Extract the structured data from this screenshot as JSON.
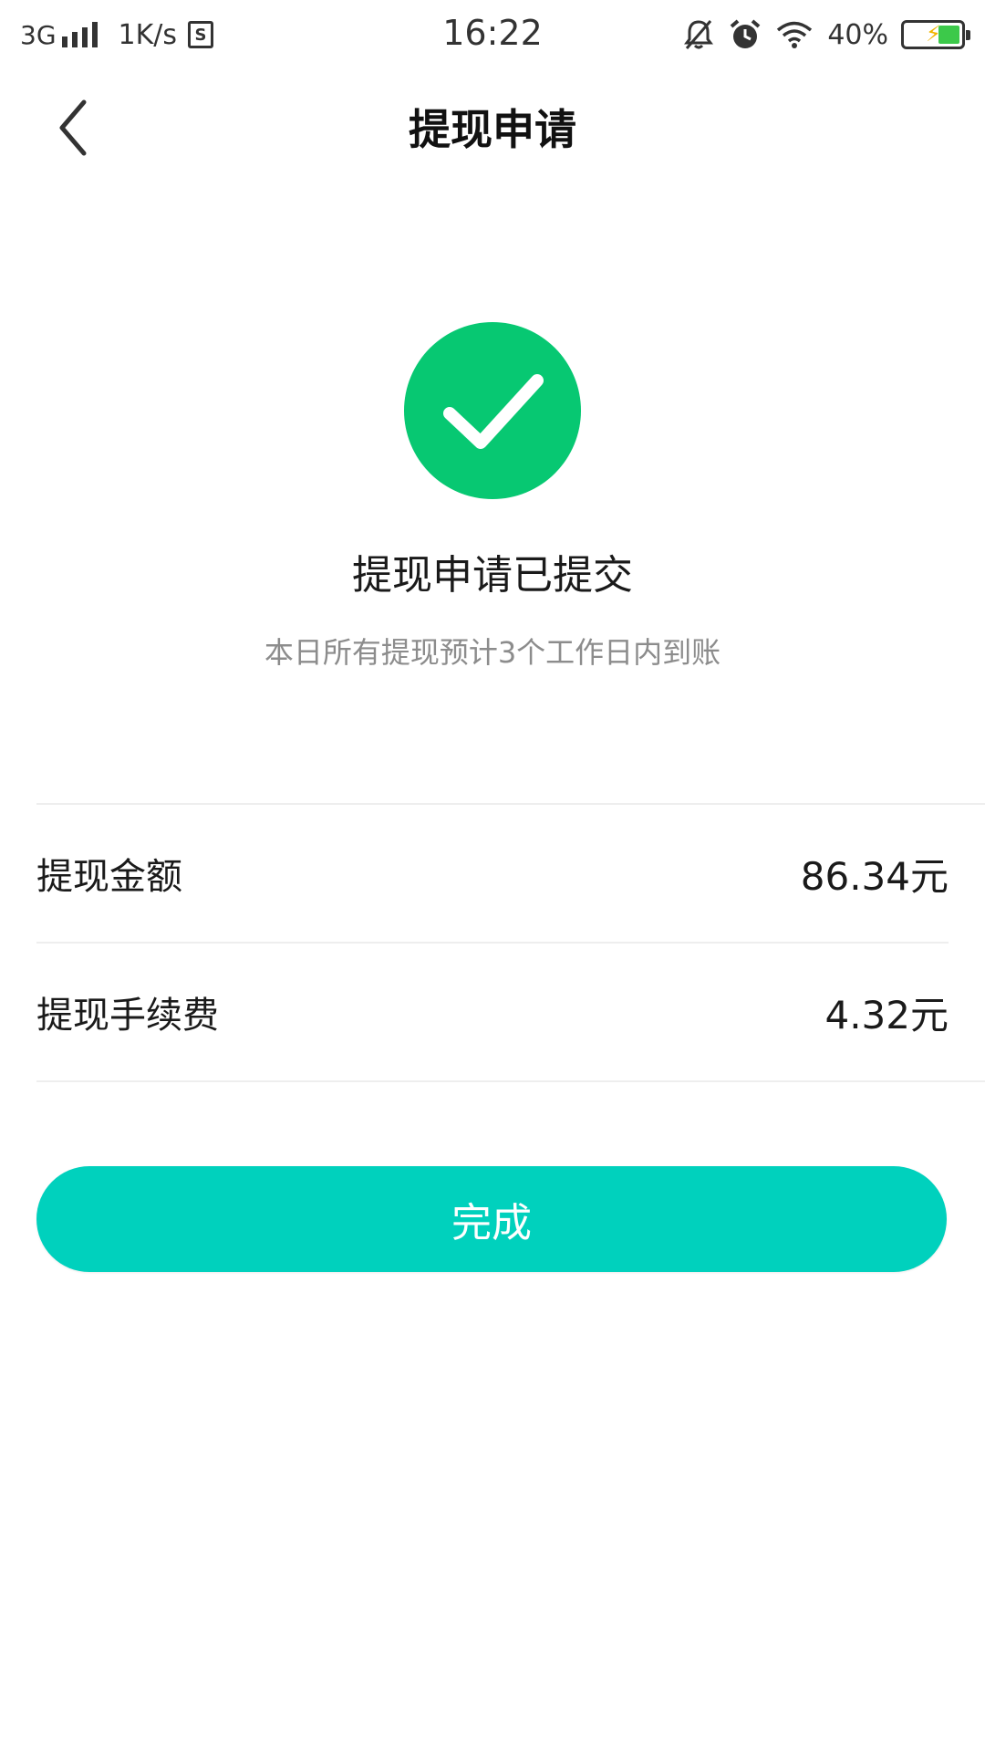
{
  "status_bar": {
    "network": "3G",
    "speed": "1K/s",
    "sim_icon": "S",
    "time": "16:22",
    "battery_percent": "40%",
    "battery_level": 0.4,
    "icons": [
      "signal-icon",
      "sim-icon",
      "mute-icon",
      "alarm-icon",
      "wifi-icon",
      "battery-icon"
    ]
  },
  "nav": {
    "title": "提现申请",
    "back_icon": "chevron-left-icon"
  },
  "result": {
    "icon": "check-icon",
    "icon_color": "#07c872",
    "title": "提现申请已提交",
    "description": "本日所有提现预计3个工作日内到账"
  },
  "details": [
    {
      "label": "提现金额",
      "value": "86.34元"
    },
    {
      "label": "提现手续费",
      "value": "4.32元"
    }
  ],
  "actions": {
    "done_label": "完成",
    "button_color": "#00d1bd"
  }
}
